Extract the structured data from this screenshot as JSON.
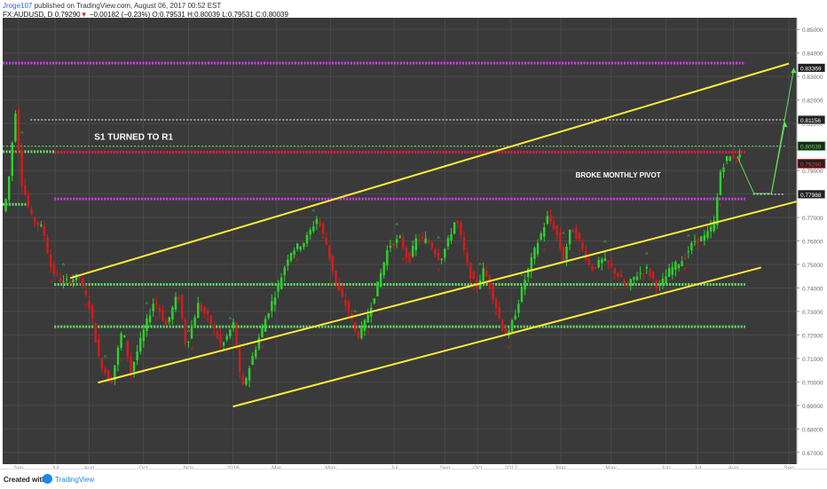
{
  "header": {
    "user": "Jroge107",
    "published": "published on TradingView.com, August 06, 2017 00:52 EST",
    "symbol": "FX:AUDUSD, D",
    "last": "0.79290",
    "change": "−0.00182 (−0.23%)",
    "ohlc": "O:0.79531 H:0.80039 L:0.79531 C:0.80039"
  },
  "footer": {
    "created": "Created with",
    "brand": "TradingView"
  },
  "colors": {
    "background": "#3a3a3a",
    "bull": "#2bd52b",
    "bear": "#d81b1b",
    "channel": "#ffeb3b",
    "magenta": "#e040fb",
    "red_level": "#ff1744",
    "green_level": "#69f06a",
    "grid": "#4a4a4a"
  },
  "chart_data": {
    "type": "candlestick",
    "x_ticks": [
      "Sep",
      "Jul",
      "Aug",
      "Oct",
      "Nov",
      "2016",
      "Mar",
      "May",
      "Jul",
      "Sep",
      "Oct",
      "2017",
      "Mar",
      "May",
      "Jun",
      "Jul",
      "Aug",
      "Sep"
    ],
    "y_ticks": [
      "0.85000",
      "0.84000",
      "0.83000",
      "0.82000",
      "0.81000",
      "0.80000",
      "0.79000",
      "0.78000",
      "0.77000",
      "0.76000",
      "0.75000",
      "0.74000",
      "0.73000",
      "0.72000",
      "0.71000",
      "0.70000",
      "0.69000",
      "0.68000",
      "0.67000"
    ],
    "ylim": [
      0.665,
      0.855
    ],
    "price_labels": [
      {
        "text": "0.83369",
        "value": 0.83369,
        "color": "#ffffff"
      },
      {
        "text": "0.81156",
        "value": 0.81156,
        "color": "#ffffff"
      },
      {
        "text": "0.80039",
        "value": 0.80039,
        "color": "#5ee05e"
      },
      {
        "text": "0.79290",
        "value": 0.7929,
        "color": "#ff3030"
      },
      {
        "text": "0.77988",
        "value": 0.77988,
        "color": "#ffffff"
      }
    ],
    "annotations": [
      {
        "text": "S1 TURNED TO R1",
        "x": 0.165,
        "y": 0.803
      },
      {
        "text": "BROKE MONTHLY PIVOT",
        "x": 0.775,
        "y": 0.787
      }
    ],
    "pivot_levels": [
      {
        "value": 0.8357,
        "x0": 0.0,
        "x1": 0.935,
        "color": "#e040fb"
      },
      {
        "value": 0.798,
        "x0": 0.0,
        "x1": 0.065,
        "color": "#69f06a"
      },
      {
        "value": 0.7978,
        "x0": 0.065,
        "x1": 0.935,
        "color": "#ff1744"
      },
      {
        "value": 0.7779,
        "x0": 0.065,
        "x1": 0.935,
        "color": "#e040fb"
      },
      {
        "value": 0.7756,
        "x0": 0.0,
        "x1": 0.03,
        "color": "#69f06a"
      },
      {
        "value": 0.7415,
        "x0": 0.065,
        "x1": 0.935,
        "color": "#69f06a"
      },
      {
        "value": 0.7235,
        "x0": 0.065,
        "x1": 0.935,
        "color": "#69f06a"
      }
    ],
    "dotted_levels": [
      {
        "value": 0.81156,
        "x0": 0.035,
        "x1": 0.985,
        "color": "#ffffff"
      },
      {
        "value": 0.77988,
        "x0": 0.945,
        "x1": 0.985,
        "color": "#ffffff"
      },
      {
        "value": 0.80039,
        "x0": 0.0,
        "x1": 0.985,
        "color": "#5ee05e"
      }
    ],
    "channels": [
      {
        "from": [
          0.085,
          0.7442
        ],
        "to": [
          0.99,
          0.8355
        ]
      },
      {
        "from": [
          0.12,
          0.6997
        ],
        "to": [
          1.0,
          0.7768
        ]
      },
      {
        "from": [
          0.29,
          0.6895
        ],
        "to": [
          0.955,
          0.7487
        ]
      }
    ],
    "projection": [
      [
        0.925,
        0.796
      ],
      [
        0.946,
        0.7802
      ],
      [
        0.968,
        0.7802
      ],
      [
        0.985,
        0.81
      ]
    ],
    "projection2": [
      [
        0.968,
        0.7802
      ],
      [
        0.996,
        0.833
      ]
    ],
    "path": [
      [
        0.0,
        0.768
      ],
      [
        0.01,
        0.78
      ],
      [
        0.02,
        0.816
      ],
      [
        0.028,
        0.785
      ],
      [
        0.04,
        0.77
      ],
      [
        0.055,
        0.765
      ],
      [
        0.065,
        0.748
      ],
      [
        0.08,
        0.742
      ],
      [
        0.1,
        0.745
      ],
      [
        0.115,
        0.73
      ],
      [
        0.125,
        0.71
      ],
      [
        0.14,
        0.699
      ],
      [
        0.155,
        0.723
      ],
      [
        0.165,
        0.704
      ],
      [
        0.18,
        0.72
      ],
      [
        0.195,
        0.735
      ],
      [
        0.21,
        0.724
      ],
      [
        0.225,
        0.738
      ],
      [
        0.235,
        0.715
      ],
      [
        0.25,
        0.733
      ],
      [
        0.265,
        0.726
      ],
      [
        0.28,
        0.715
      ],
      [
        0.295,
        0.725
      ],
      [
        0.305,
        0.696
      ],
      [
        0.32,
        0.712
      ],
      [
        0.335,
        0.727
      ],
      [
        0.35,
        0.74
      ],
      [
        0.365,
        0.755
      ],
      [
        0.385,
        0.76
      ],
      [
        0.4,
        0.77
      ],
      [
        0.412,
        0.758
      ],
      [
        0.425,
        0.74
      ],
      [
        0.44,
        0.73
      ],
      [
        0.45,
        0.719
      ],
      [
        0.46,
        0.725
      ],
      [
        0.475,
        0.74
      ],
      [
        0.49,
        0.758
      ],
      [
        0.505,
        0.761
      ],
      [
        0.515,
        0.751
      ],
      [
        0.525,
        0.761
      ],
      [
        0.54,
        0.76
      ],
      [
        0.555,
        0.752
      ],
      [
        0.565,
        0.76
      ],
      [
        0.575,
        0.77
      ],
      [
        0.59,
        0.748
      ],
      [
        0.6,
        0.74
      ],
      [
        0.61,
        0.748
      ],
      [
        0.62,
        0.738
      ],
      [
        0.632,
        0.724
      ],
      [
        0.64,
        0.719
      ],
      [
        0.65,
        0.73
      ],
      [
        0.66,
        0.742
      ],
      [
        0.675,
        0.757
      ],
      [
        0.69,
        0.77
      ],
      [
        0.7,
        0.765
      ],
      [
        0.71,
        0.752
      ],
      [
        0.72,
        0.766
      ],
      [
        0.73,
        0.76
      ],
      [
        0.745,
        0.748
      ],
      [
        0.76,
        0.752
      ],
      [
        0.775,
        0.747
      ],
      [
        0.79,
        0.74
      ],
      [
        0.8,
        0.745
      ],
      [
        0.815,
        0.748
      ],
      [
        0.83,
        0.74
      ],
      [
        0.845,
        0.748
      ],
      [
        0.86,
        0.752
      ],
      [
        0.875,
        0.76
      ],
      [
        0.89,
        0.762
      ],
      [
        0.9,
        0.768
      ],
      [
        0.908,
        0.79
      ],
      [
        0.915,
        0.795
      ],
      [
        0.923,
        0.796
      ],
      [
        0.93,
        0.796
      ]
    ]
  }
}
